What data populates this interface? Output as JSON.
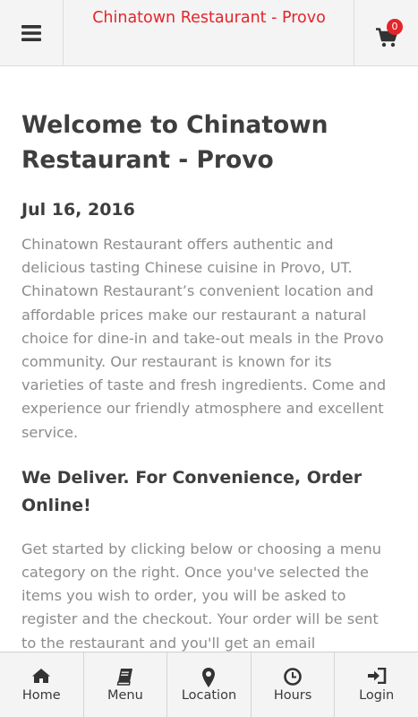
{
  "header": {
    "title": "Chinatown Restaurant - Provo",
    "menu_icon": "hamburger-menu-icon",
    "cart_icon": "shopping-cart-icon",
    "cart_count": "0"
  },
  "main": {
    "heading": "Welcome to Chinatown Restaurant - Provo",
    "date": "Jul 16, 2016",
    "intro": "Chinatown Restaurant offers authentic and delicious tasting Chinese cuisine in Provo, UT. Chinatown Restaurant’s convenient location and affordable prices make our restaurant a natural choice for dine-in and take-out meals in the Provo community. Our restaurant is known for its varieties of taste and fresh ingredients. Come and experience our friendly atmosphere and excellent service.",
    "subheading": "We Deliver. For Convenience, Order Online!",
    "body": "Get started by clicking below or choosing a menu category on the right. Once you've selected the items you wish to order, you will be asked to register and the checkout. Your order will be sent to the restaurant and you'll get an email confirmation."
  },
  "footer": {
    "tabs": [
      {
        "label": "Home",
        "icon": "home-icon"
      },
      {
        "label": "Menu",
        "icon": "book-icon"
      },
      {
        "label": "Location",
        "icon": "map-marker-icon"
      },
      {
        "label": "Hours",
        "icon": "clock-icon"
      },
      {
        "label": "Login",
        "icon": "sign-in-icon"
      }
    ]
  },
  "colors": {
    "accent": "#e4252b",
    "heading": "#3e3e3e",
    "body_text": "#8c8c8c",
    "bar_bg": "#f4f4f4"
  }
}
